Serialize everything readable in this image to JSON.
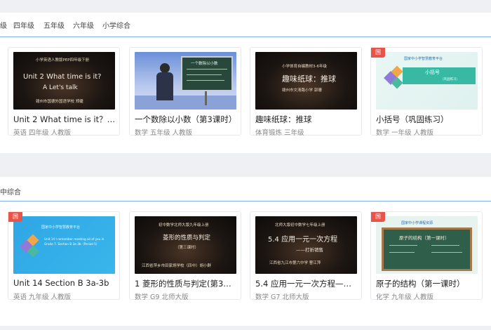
{
  "sections": [
    {
      "tabs": [
        "级",
        "四年级",
        "五年级",
        "六年级",
        "小学综合"
      ],
      "cards": [
        {
          "title": "Unit 2 What time is it？ A ...",
          "meta": "英语  四年级  人教版",
          "thumb": {
            "kind": "dark",
            "lines": [
              "小学英语人教版PEP四年级下册",
              "Unit 2  What time is it?",
              "A  Let's talk",
              "赣州市国德外国语学校  郑婕"
            ]
          }
        },
        {
          "title": "一个数除以小数（第3课时）",
          "meta": "数学  五年级  人教版",
          "thumb": {
            "kind": "studio",
            "lines": [
              "一个数除以小数"
            ]
          }
        },
        {
          "title": "趣味纸球：推球",
          "meta": "体育锻炼  三年级",
          "thumb": {
            "kind": "dark",
            "lines": [
              "小学体育自编教材3-6年级",
              "趣味纸球：推球",
              "赣州市文清路小学  郭珊"
            ]
          }
        },
        {
          "title": "小括号（巩固练习）",
          "meta": "数学  一年级  人教版",
          "badge": "国",
          "thumb": {
            "kind": "light",
            "lines": [
              "国家中小学智慧教育平台",
              "小括号",
              "（巩固练习）"
            ]
          }
        }
      ]
    },
    {
      "tabs": [
        "中综合"
      ],
      "cards": [
        {
          "title": "Unit 14 Section B 3a-3b",
          "meta": "英语  九年级  人教版",
          "badge": "国",
          "thumb": {
            "kind": "blue",
            "lines": [
              "国家中小学智慧教育平台",
              "Unit 14 I remember meeting all of you in",
              "Grade 7.  Section B  3a-3b（Period 5）"
            ]
          }
        },
        {
          "title": "1 菱形的性质与判定(第3课...",
          "meta": "数学  G9  北师大版",
          "thumb": {
            "kind": "dark",
            "lines": [
              "初中数学北师大版九年级上册",
              "菱形的性质与判定",
              "（第三课时）",
              "江西省萍乡市田家炳学校（四中）胡小群"
            ]
          }
        },
        {
          "title": "5.4 应用一元一次方程——...",
          "meta": "数学  G7  北师大版",
          "thumb": {
            "kind": "dark",
            "lines": [
              "北师大版初中数学七年级上册",
              "5.4  应用一元一次方程",
              "——打折销售",
              "江西省九江市第六中学    曹江萍"
            ]
          }
        },
        {
          "title": "原子的结构（第一课时）",
          "meta": "化学  九年级  人教版",
          "badge": "国",
          "thumb": {
            "kind": "green",
            "lines": [
              "国家中小学课程资源",
              "原子的结构（第一课时）"
            ]
          }
        }
      ]
    }
  ]
}
